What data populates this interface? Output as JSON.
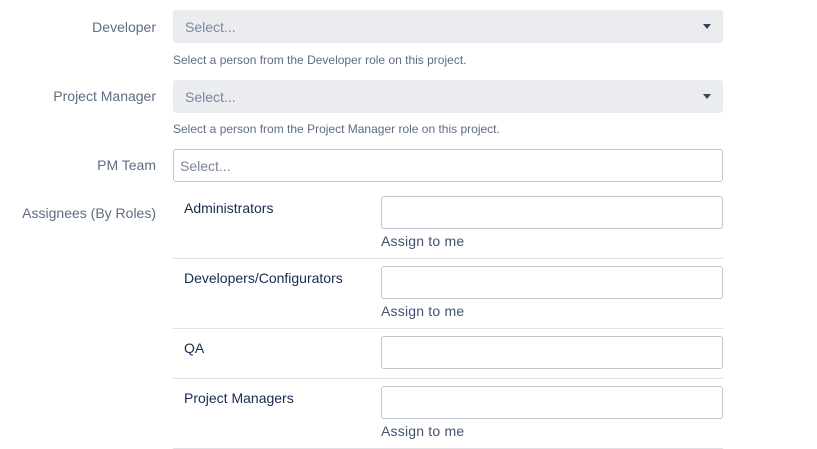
{
  "developer": {
    "label": "Developer",
    "placeholder": "Select...",
    "help": "Select a person from the Developer role on this project."
  },
  "project_manager": {
    "label": "Project Manager",
    "placeholder": "Select...",
    "help": "Select a person from the Project Manager role on this project."
  },
  "pm_team": {
    "label": "PM Team",
    "placeholder": "Select..."
  },
  "assignees": {
    "label": "Assignees (By Roles)",
    "assign_label": "Assign to me",
    "roles": [
      {
        "name": "Administrators",
        "value": "",
        "has_assign": true
      },
      {
        "name": "Developers/Configurators",
        "value": "",
        "has_assign": true
      },
      {
        "name": "QA",
        "value": "",
        "has_assign": false
      },
      {
        "name": "Project Managers",
        "value": "",
        "has_assign": true
      }
    ]
  },
  "colors": {
    "select_bg": "#ebecf0",
    "label": "#5e6c84",
    "link": "#42526e",
    "border": "#c1c7d0"
  }
}
